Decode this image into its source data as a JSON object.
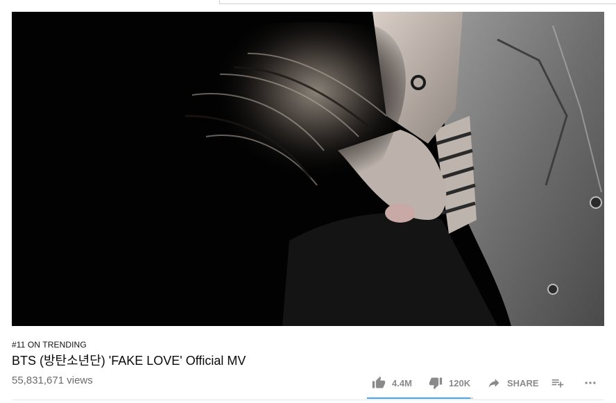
{
  "video": {
    "trending": "#11 ON TRENDING",
    "title": "BTS (방탄소년단) 'FAKE LOVE' Official MV",
    "views": "55,831,671 views"
  },
  "actions": {
    "likes": "4.4M",
    "dislikes": "120K",
    "share_label": "SHARE",
    "like_ratio": 0.973
  },
  "icons": [
    "thumb-up-icon",
    "thumb-down-icon",
    "share-arrow-icon",
    "playlist-add-icon",
    "more-icon"
  ],
  "colors": {
    "accent": "#3ea6ff",
    "text": "#0a0a0a",
    "muted": "#6b6b6b"
  }
}
